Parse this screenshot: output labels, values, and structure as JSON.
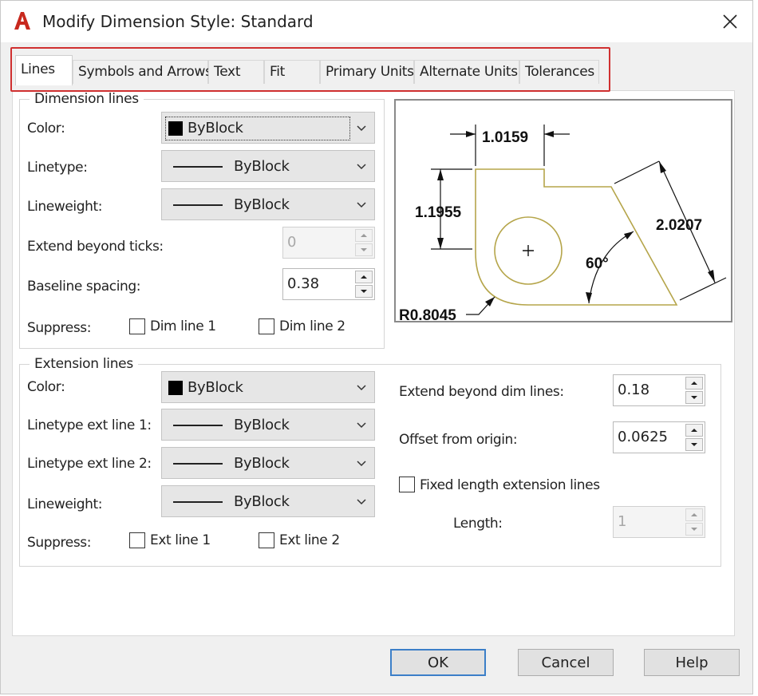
{
  "window": {
    "title": "Modify Dimension Style: Standard"
  },
  "tabs": [
    {
      "label": "Lines",
      "active": true
    },
    {
      "label": "Symbols and Arrows",
      "active": false
    },
    {
      "label": "Text",
      "active": false
    },
    {
      "label": "Fit",
      "active": false
    },
    {
      "label": "Primary Units",
      "active": false
    },
    {
      "label": "Alternate Units",
      "active": false
    },
    {
      "label": "Tolerances",
      "active": false
    }
  ],
  "dimension_lines": {
    "group_label": "Dimension lines",
    "color_label": "Color:",
    "color_value": "ByBlock",
    "linetype_label": "Linetype:",
    "linetype_value": "ByBlock",
    "lineweight_label": "Lineweight:",
    "lineweight_value": "ByBlock",
    "extend_ticks_label": "Extend beyond ticks:",
    "extend_ticks_value": "0",
    "baseline_label": "Baseline spacing:",
    "baseline_value": "0.38",
    "suppress_label": "Suppress:",
    "dim_line_1": "Dim line 1",
    "dim_line_2": "Dim line 2"
  },
  "extension_lines": {
    "group_label": "Extension lines",
    "color_label": "Color:",
    "color_value": "ByBlock",
    "linetype1_label": "Linetype ext line 1:",
    "linetype1_value": "ByBlock",
    "linetype2_label": "Linetype ext line 2:",
    "linetype2_value": "ByBlock",
    "lineweight_label": "Lineweight:",
    "lineweight_value": "ByBlock",
    "suppress_label": "Suppress:",
    "ext_line_1": "Ext line 1",
    "ext_line_2": "Ext line 2",
    "extend_beyond_label": "Extend beyond dim lines:",
    "extend_beyond_value": "0.18",
    "offset_label": "Offset from origin:",
    "offset_value": "0.0625",
    "fixed_length_label": "Fixed length extension lines",
    "length_label": "Length:",
    "length_value": "1"
  },
  "preview": {
    "dim_top": "1.0159",
    "dim_left": "1.1955",
    "dim_right": "2.0207",
    "dim_angle": "60°",
    "dim_radius": "R0.8045"
  },
  "buttons": {
    "ok": "OK",
    "cancel": "Cancel",
    "help": "Help"
  },
  "colors": {
    "highlight_border": "#d03030",
    "default_button_border": "#3c7fc8",
    "preview_shape": "#b5a54a"
  },
  "icons": [
    "autocad-icon",
    "close-icon",
    "chevron-down-icon",
    "spin-up-icon",
    "spin-down-icon"
  ]
}
